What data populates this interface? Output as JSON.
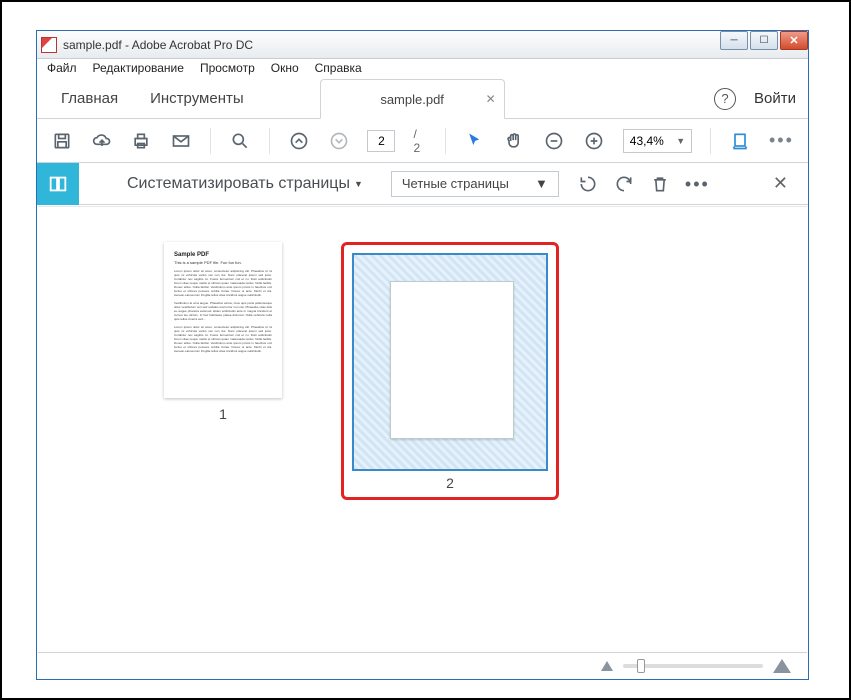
{
  "window": {
    "title": "sample.pdf - Adobe Acrobat Pro DC"
  },
  "menu": {
    "file": "Файл",
    "edit": "Редактирование",
    "view": "Просмотр",
    "window_m": "Окно",
    "help": "Справка"
  },
  "tabs": {
    "home": "Главная",
    "tools": "Инструменты",
    "file": "sample.pdf",
    "login": "Войти"
  },
  "toolbar": {
    "page_current": "2",
    "page_total": "/  2",
    "zoom_value": "43,4%"
  },
  "secondary": {
    "organize_label": "Систематизировать страницы",
    "filter_value": "Четные страницы"
  },
  "thumbs": {
    "page1_title": "Sample PDF",
    "page1_sub": "This is a sample PDF file. Fun fun fun.",
    "page1_para": "Lorem ipsum dolor sit amet, consectetur adipiscing elit. Phasellus id mi quis mi vehicula varius nec non dui. Nunc placerat ipsum sed justo. Curabitur nec sagittis mi. Fusce fermentum nisl et mi. Duis sollicitudin lorem vitae neque mattis et ultrices quam malesuada varius. Nulla facilisi. Donec tellus. Nulla facilisi. Vestibulum ante ipsum primis in faucibus orci luctus et ultrices posuere cubilia Curae. Donec ut ante. Morbi et dui. Aenean elementum fringilla tellus vitae tincidunt augue sollicitudin.",
    "page1_para2": "Vestibulum at urna augue. Phasellus varius, risus quis porta pellentesque dolor vestibulum orci sed sodales erat tortor non nisi. Phasellus vitae felis eu augue pharetra euismod. Etiam sollicitudin ante in magna tincidunt et cursus leo dictum. In hac habitasse platea dictumst. Nulla vehicula nulla quis tellus viverra sed...",
    "page1_label": "1",
    "page2_label": "2"
  }
}
